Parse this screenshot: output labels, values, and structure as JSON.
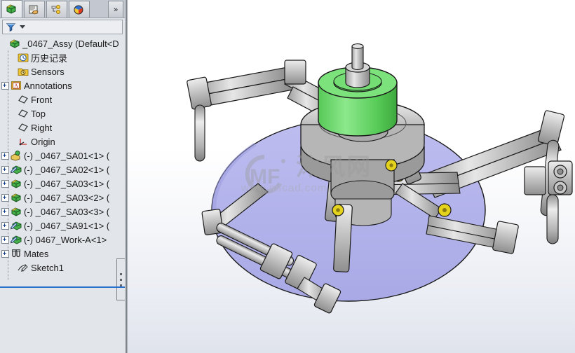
{
  "panel": {
    "tabs": [
      {
        "name": "feature-manager-design-tree",
        "icon": "green-box-tree-icon",
        "active": true
      },
      {
        "name": "property-manager",
        "icon": "hand-page-icon",
        "active": false
      },
      {
        "name": "configuration-manager",
        "icon": "config-yellow-icon",
        "active": false
      },
      {
        "name": "display-manager",
        "icon": "color-wheel-icon",
        "active": false
      }
    ],
    "overflow_label": "»",
    "filter": {
      "icon": "filter-funnel-icon",
      "placeholder": "",
      "value": ""
    }
  },
  "tree": {
    "nodes": [
      {
        "label": "_0467_Assy  (Default<D",
        "icon": "assembly-icon",
        "indent": 0,
        "expander": "none",
        "selected": false
      },
      {
        "label": "历史记录",
        "icon": "history-clock-icon",
        "indent": 1,
        "expander": "none",
        "selected": false
      },
      {
        "label": "Sensors",
        "icon": "sensors-folder-icon",
        "indent": 1,
        "expander": "none",
        "selected": false
      },
      {
        "label": "Annotations",
        "icon": "annotations-icon",
        "indent": 1,
        "expander": "plus",
        "selected": false
      },
      {
        "label": "Front",
        "icon": "plane-icon",
        "indent": 1,
        "expander": "none",
        "selected": false
      },
      {
        "label": "Top",
        "icon": "plane-icon",
        "indent": 1,
        "expander": "none",
        "selected": false
      },
      {
        "label": "Right",
        "icon": "plane-icon",
        "indent": 1,
        "expander": "none",
        "selected": false
      },
      {
        "label": "Origin",
        "icon": "origin-icon",
        "indent": 1,
        "expander": "none",
        "selected": false
      },
      {
        "label": "(-) _0467_SA01<1> (",
        "icon": "subassembly-a-icon",
        "indent": 1,
        "expander": "plus",
        "selected": false
      },
      {
        "label": "(-) _0467_SA02<1> (",
        "icon": "subassembly-b-icon",
        "indent": 1,
        "expander": "plus",
        "selected": false
      },
      {
        "label": "(-) _0467_SA03<1> (",
        "icon": "part-icon",
        "indent": 1,
        "expander": "plus",
        "selected": false
      },
      {
        "label": "(-) _0467_SA03<2> (",
        "icon": "part-icon",
        "indent": 1,
        "expander": "plus",
        "selected": false
      },
      {
        "label": "(-) _0467_SA03<3> (",
        "icon": "part-icon",
        "indent": 1,
        "expander": "plus",
        "selected": false
      },
      {
        "label": "(-) _0467_SA91<1> (",
        "icon": "subassembly-b-icon",
        "indent": 1,
        "expander": "plus",
        "selected": false
      },
      {
        "label": "(-) 0467_Work-A<1>",
        "icon": "subassembly-b-icon",
        "indent": 1,
        "expander": "plus",
        "selected": false
      },
      {
        "label": "Mates",
        "icon": "mates-paperclip-icon",
        "indent": 1,
        "expander": "plus",
        "selected": false
      },
      {
        "label": "Sketch1",
        "icon": "sketch-pencil-icon",
        "indent": 1,
        "expander": "none",
        "selected": false
      }
    ]
  },
  "viewport": {
    "watermark": {
      "logo": "MF",
      "brand": "沐风网",
      "url": "www.mfcad.com"
    },
    "model": {
      "name": "0467 rotary multi-arm fixture assembly",
      "colors": {
        "base_plate": "#b3b3ea",
        "motor": "#6fdc6f",
        "metal_light": "#d9d9d9",
        "metal_mid": "#b0b0b0",
        "metal_dark": "#8a8a8a",
        "pivot": "#e8d21a",
        "edge": "#1a1a1a"
      }
    }
  }
}
